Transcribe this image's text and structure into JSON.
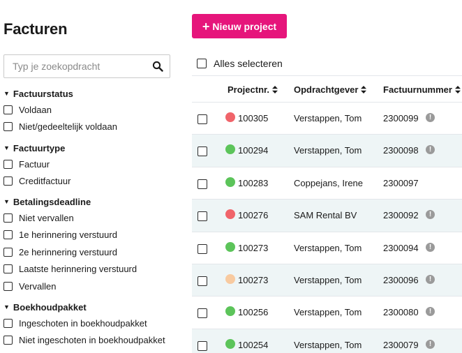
{
  "page": {
    "title": "Facturen"
  },
  "search": {
    "placeholder": "Typ je zoekopdracht"
  },
  "icons": {
    "search": "search-icon",
    "info": "info-icon",
    "sort": "sort-icon",
    "plus": "plus-icon",
    "caret": "caret-down-icon"
  },
  "colors": {
    "accent": "#e6157b",
    "status_green": "#5cc45a",
    "status_red": "#f0646a",
    "status_orange": "#f8caa0",
    "row_alt": "#eef5f6"
  },
  "filters": [
    {
      "title": "Factuurstatus",
      "options": [
        "Voldaan",
        "Niet/gedeeltelijk voldaan"
      ]
    },
    {
      "title": "Factuurtype",
      "options": [
        "Factuur",
        "Creditfactuur"
      ]
    },
    {
      "title": "Betalingsdeadline",
      "options": [
        "Niet vervallen",
        "1e herinnering verstuurd",
        "2e herinnering verstuurd",
        "Laatste herinnering verstuurd",
        "Vervallen"
      ]
    },
    {
      "title": "Boekhoudpakket",
      "options": [
        "Ingeschoten in boekhoudpakket",
        "Niet ingeschoten in boekhoudpakket"
      ]
    }
  ],
  "toolbar": {
    "new_project_label": "Nieuw project",
    "plus": "+"
  },
  "table": {
    "select_all_label": "Alles selecteren",
    "columns": [
      "Projectnr.",
      "Opdrachtgever",
      "Factuurnummer"
    ],
    "rows": [
      {
        "status": "red",
        "project": "100305",
        "client": "Verstappen, Tom",
        "invoice": "2300099",
        "info": true
      },
      {
        "status": "green",
        "project": "100294",
        "client": "Verstappen, Tom",
        "invoice": "2300098",
        "info": true
      },
      {
        "status": "green",
        "project": "100283",
        "client": "Coppejans, Irene",
        "invoice": "2300097",
        "info": false
      },
      {
        "status": "red",
        "project": "100276",
        "client": "SAM Rental BV",
        "invoice": "2300092",
        "info": true
      },
      {
        "status": "green",
        "project": "100273",
        "client": "Verstappen, Tom",
        "invoice": "2300094",
        "info": true
      },
      {
        "status": "orange",
        "project": "100273",
        "client": "Verstappen, Tom",
        "invoice": "2300096",
        "info": true
      },
      {
        "status": "green",
        "project": "100256",
        "client": "Verstappen, Tom",
        "invoice": "2300080",
        "info": true
      },
      {
        "status": "green",
        "project": "100254",
        "client": "Verstappen, Tom",
        "invoice": "2300079",
        "info": true
      }
    ]
  }
}
